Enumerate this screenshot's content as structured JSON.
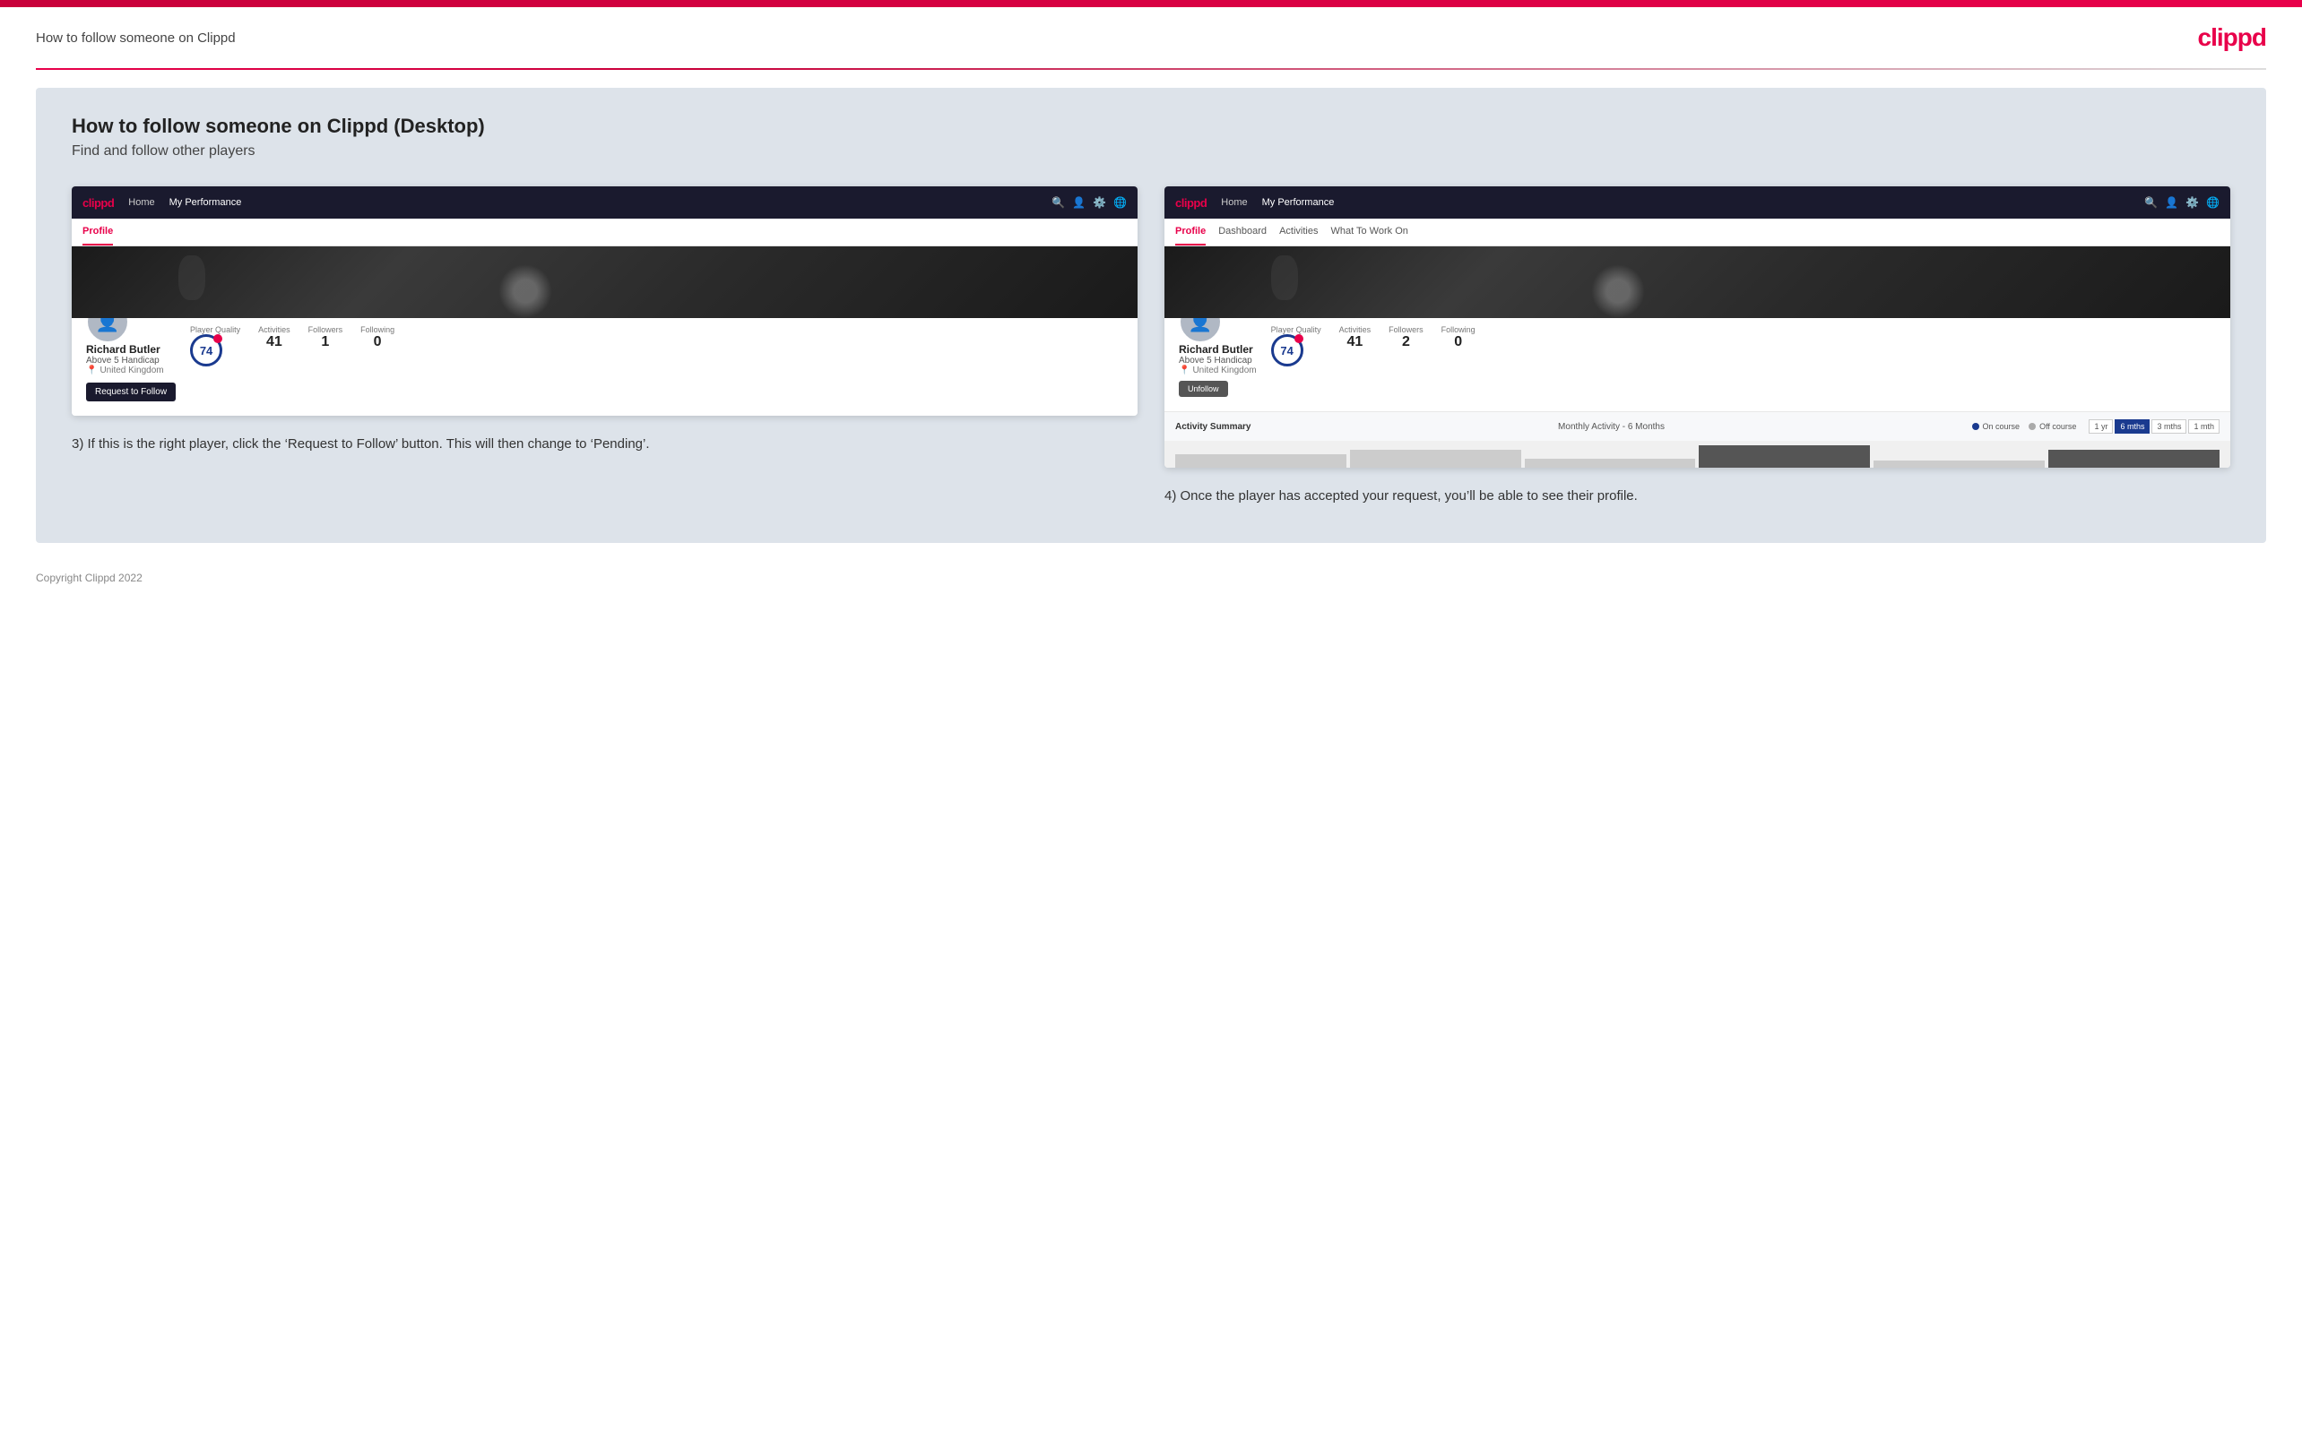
{
  "topbar": {
    "title": "How to follow someone on Clippd",
    "logo": "clippd"
  },
  "main": {
    "heading": "How to follow someone on Clippd (Desktop)",
    "subheading": "Find and follow other players"
  },
  "screenshot1": {
    "nav": {
      "logo": "clippd",
      "links": [
        "Home",
        "My Performance"
      ]
    },
    "subnav": {
      "items": [
        "Profile"
      ]
    },
    "profile": {
      "name": "Richard Butler",
      "handicap": "Above 5 Handicap",
      "location": "United Kingdom",
      "playerQuality": "74",
      "playerQualityLabel": "Player Quality",
      "activities": "41",
      "activitiesLabel": "Activities",
      "followers": "1",
      "followersLabel": "Followers",
      "following": "0",
      "followingLabel": "Following",
      "requestButton": "Request to Follow"
    }
  },
  "screenshot2": {
    "nav": {
      "logo": "clippd",
      "links": [
        "Home",
        "My Performance"
      ]
    },
    "subnav": {
      "items": [
        "Profile",
        "Dashboard",
        "Activities",
        "What To Work On"
      ]
    },
    "profile": {
      "name": "Richard Butler",
      "handicap": "Above 5 Handicap",
      "location": "United Kingdom",
      "playerQuality": "74",
      "playerQualityLabel": "Player Quality",
      "activities": "41",
      "activitiesLabel": "Activities",
      "followers": "2",
      "followersLabel": "Followers",
      "following": "0",
      "followingLabel": "Following",
      "unfollowButton": "Unfollow"
    },
    "activitySummary": {
      "label": "Activity Summary",
      "period": "Monthly Activity - 6 Months",
      "filters": [
        "On course",
        "Off course"
      ],
      "timeButtons": [
        "1 yr",
        "6 mths",
        "3 mths",
        "1 mth"
      ]
    }
  },
  "step3": {
    "text": "3) If this is the right player, click the ‘Request to Follow’ button. This will then change to ‘Pending’."
  },
  "step4": {
    "text": "4) Once the player has accepted your request, you’ll be able to see their profile."
  },
  "footer": {
    "copyright": "Copyright Clippd 2022"
  }
}
